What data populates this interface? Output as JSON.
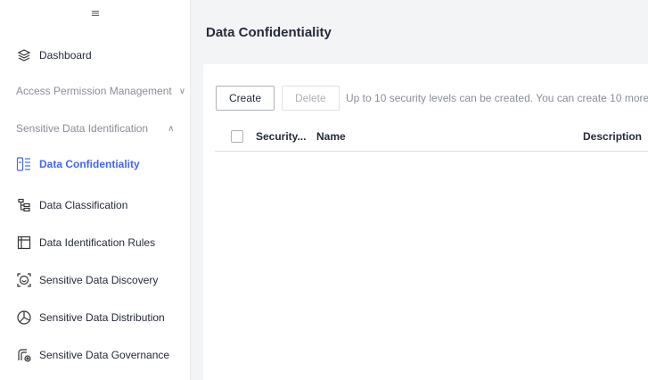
{
  "sidebar": {
    "collapse_glyph": "≡",
    "dashboard": "Dashboard",
    "group_access": "Access Permission Management",
    "group_sensitive": "Sensitive Data Identification",
    "items": [
      {
        "label": "Data Confidentiality",
        "icon": "data-confidentiality-icon",
        "active": true
      },
      {
        "label": "Data Classification",
        "icon": "data-classification-icon"
      },
      {
        "label": "Data Identification Rules",
        "icon": "identification-rules-icon"
      },
      {
        "label": "Sensitive Data Discovery",
        "icon": "data-discovery-icon"
      },
      {
        "label": "Sensitive Data Distribution",
        "icon": "data-distribution-icon"
      },
      {
        "label": "Sensitive Data Governance",
        "icon": "data-governance-icon"
      }
    ]
  },
  "page": {
    "title": "Data Confidentiality"
  },
  "toolbar": {
    "create_label": "Create",
    "delete_label": "Delete",
    "hint": "Up to 10 security levels can be created. You can create 10 more."
  },
  "table": {
    "columns": [
      "Security...",
      "Name",
      "Description"
    ]
  },
  "colors": {
    "accent": "#4466f2",
    "muted": "#8a8e99"
  }
}
